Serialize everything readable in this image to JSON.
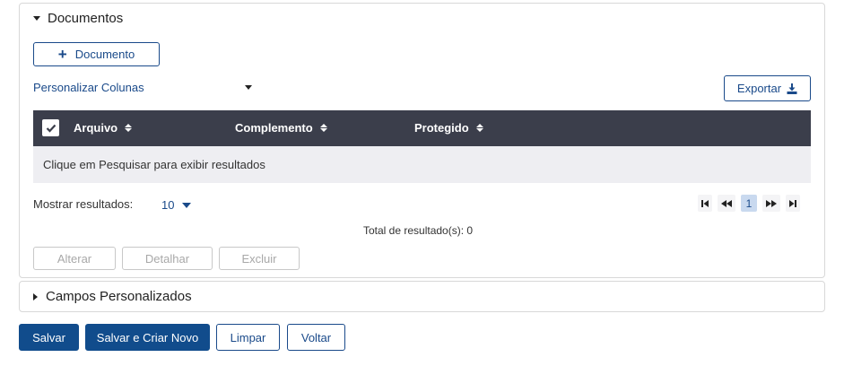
{
  "documentos": {
    "title": "Documentos",
    "add_button": "Documento",
    "personalizar_colunas": "Personalizar Colunas",
    "export_button": "Exportar",
    "table": {
      "columns": [
        "Arquivo",
        "Complemento",
        "Protegido"
      ],
      "empty_message": "Clique em Pesquisar para exibir resultados"
    },
    "mostrar_resultados_label": "Mostrar resultados:",
    "page_size": "10",
    "current_page": "1",
    "total_label": "Total de resultado(s): 0",
    "action_buttons": [
      "Alterar",
      "Detalhar",
      "Excluir"
    ]
  },
  "campos_personalizados": {
    "title": "Campos Personalizados"
  },
  "footer_buttons": {
    "salvar": "Salvar",
    "salvar_criar_novo": "Salvar e Criar Novo",
    "limpar": "Limpar",
    "voltar": "Voltar"
  },
  "colors": {
    "primary": "#114c8c",
    "table_header": "#3b3e4b",
    "empty_row": "#eeeef2"
  }
}
